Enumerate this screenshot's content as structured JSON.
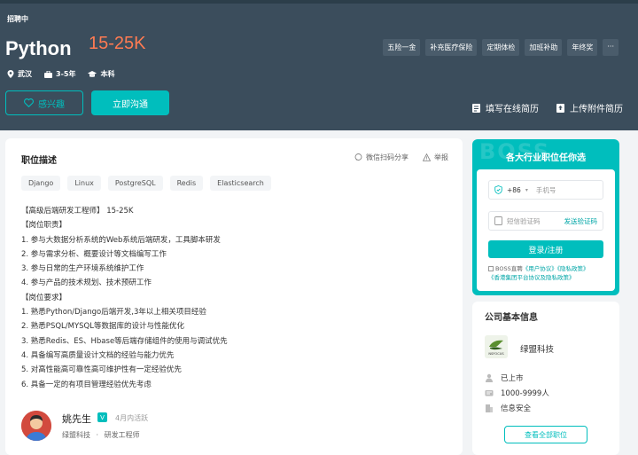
{
  "header": {
    "status": "招聘中",
    "title": "Python",
    "salary": "15-25K",
    "meta": [
      {
        "icon": "location-pin-icon",
        "text": "武汉"
      },
      {
        "icon": "briefcase-icon",
        "text": "3-5年"
      },
      {
        "icon": "graduation-cap-icon",
        "text": "本科"
      }
    ],
    "benefits": [
      "五险一金",
      "补充医疗保险",
      "定期体检",
      "加班补助",
      "年终奖",
      "···"
    ],
    "interest_label": "感兴趣",
    "chat_label": "立即沟通",
    "online_resume_label": "填写在线简历",
    "upload_resume_label": "上传附件简历"
  },
  "main": {
    "section_title": "职位描述",
    "share_label": "微信扫码分享",
    "report_label": "举报",
    "tags": [
      "Django",
      "Linux",
      "PostgreSQL",
      "Redis",
      "Elasticsearch"
    ],
    "description": [
      "【高级后端研发工程师】 15-25K",
      "【岗位职责】",
      "1. 参与大数据分析系统的Web系统后端研发，工具脚本研发",
      "2. 参与需求分析、概要设计等文档编写工作",
      "3. 参与日常的生产环境系统维护工作",
      "4. 参与产品的技术规划、技术预研工作",
      "【岗位要求】",
      "1. 熟悉Python/Django后端开发,3年以上相关项目经验",
      "2. 熟悉PSQL/MYSQL等数据库的设计与性能优化",
      "3. 熟悉Redis、ES、Hbase等后端存储组件的使用与调试优先",
      "4. 具备编写高质量设计文档的经验与能力优先",
      "5. 对高性能高可靠性高可维护性有一定经验优先",
      "6. 具备一定的有项目管理经验优先考虑"
    ],
    "recruiter": {
      "name": "姚先生",
      "badge": "V",
      "active": "4月内活跃",
      "company": "绿盟科技",
      "separator": "·",
      "position": "研发工程师"
    }
  },
  "login": {
    "watermark": "BOSS",
    "title": "各大行业职位任你选",
    "country_code": "+86",
    "phone_placeholder": "手机号",
    "sms_placeholder": "短信验证码",
    "send_code_label": "发送验证码",
    "login_label": "登录/注册",
    "agree_prefix": "BOSS直聘",
    "agree_link1": "《用户协议》",
    "agree_link2": "《隐私政策》",
    "agree_link3": "《香港集团平台协议及隐私政策》"
  },
  "company": {
    "section_title": "公司基本信息",
    "name": "绿盟科技",
    "logo_text": "NSFOCUS",
    "listed": "已上市",
    "size": "1000-9999人",
    "industry": "信息安全",
    "view_all_label": "查看全部职位"
  },
  "colors": {
    "accent": "#00bebd",
    "salary": "#ff7b52",
    "header_bg": "#3b4d5c"
  }
}
